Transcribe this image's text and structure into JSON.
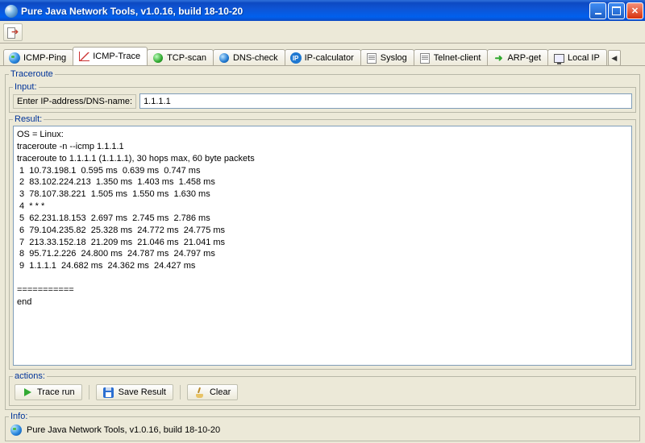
{
  "window": {
    "title": "Pure Java Network Tools,  v1.0.16, build 18-10-20"
  },
  "tabs": [
    {
      "label": "ICMP-Ping",
      "icon": "globe"
    },
    {
      "label": "ICMP-Trace",
      "icon": "chart",
      "active": true
    },
    {
      "label": "TCP-scan",
      "icon": "green"
    },
    {
      "label": "DNS-check",
      "icon": "blue"
    },
    {
      "label": "IP-calculator",
      "icon": "ip"
    },
    {
      "label": "Syslog",
      "icon": "doc"
    },
    {
      "label": "Telnet-client",
      "icon": "doc"
    },
    {
      "label": "ARP-get",
      "icon": "arrow"
    },
    {
      "label": "Local IP",
      "icon": "mon"
    }
  ],
  "traceroute": {
    "legend": "Traceroute",
    "input_legend": "Input:",
    "input_label": "Enter IP-address/DNS-name:",
    "input_value": "1.1.1.1",
    "result_legend": "Result:",
    "result_text": "OS = Linux:\ntraceroute -n --icmp 1.1.1.1\ntraceroute to 1.1.1.1 (1.1.1.1), 30 hops max, 60 byte packets\n 1  10.73.198.1  0.595 ms  0.639 ms  0.747 ms\n 2  83.102.224.213  1.350 ms  1.403 ms  1.458 ms\n 3  78.107.38.221  1.505 ms  1.550 ms  1.630 ms\n 4  * * *\n 5  62.231.18.153  2.697 ms  2.745 ms  2.786 ms\n 6  79.104.235.82  25.328 ms  24.772 ms  24.775 ms\n 7  213.33.152.18  21.209 ms  21.046 ms  21.041 ms\n 8  95.71.2.226  24.800 ms  24.787 ms  24.797 ms\n 9  1.1.1.1  24.682 ms  24.362 ms  24.427 ms\n\n===========\nend"
  },
  "actions": {
    "legend": "actions:",
    "trace_run": "Trace run",
    "save_result": "Save Result",
    "clear": "Clear"
  },
  "info": {
    "legend": "Info:",
    "text": "Pure Java Network Tools,  v1.0.16, build 18-10-20"
  }
}
